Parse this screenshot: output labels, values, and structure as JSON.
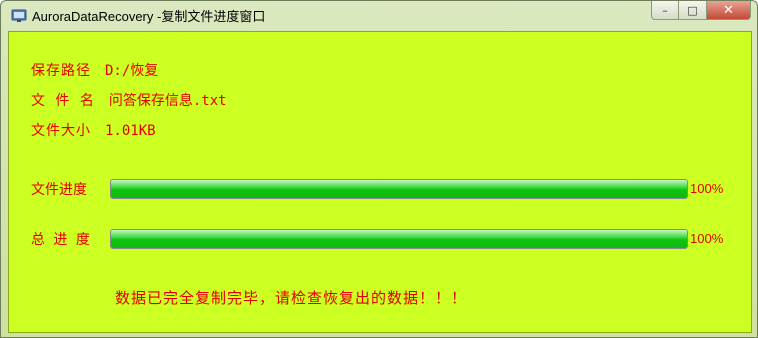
{
  "window": {
    "title": "AuroraDataRecovery -复制文件进度窗口",
    "controls": {
      "minimize": "–",
      "maximize": "□",
      "close": "✕"
    }
  },
  "info": {
    "path_label": "保存路径",
    "path_value": "D:/恢复",
    "name_label": "文 件 名",
    "name_value": "问答保存信息.txt",
    "size_label": "文件大小",
    "size_value": "1.01KB"
  },
  "progress": {
    "file_label": "文件进度",
    "file_percent_text": "100%",
    "file_fraction": 1.0,
    "total_label": "总 进 度",
    "total_percent_text": "100%",
    "total_fraction": 1.0
  },
  "message": "数据已完全复制完毕，请检查恢复出的数据！！！",
  "colors": {
    "client_bg": "#ccff22",
    "text_red": "#e60000",
    "progress_green": "#0ec40e"
  },
  "icons": {
    "app": "app-window-icon"
  }
}
